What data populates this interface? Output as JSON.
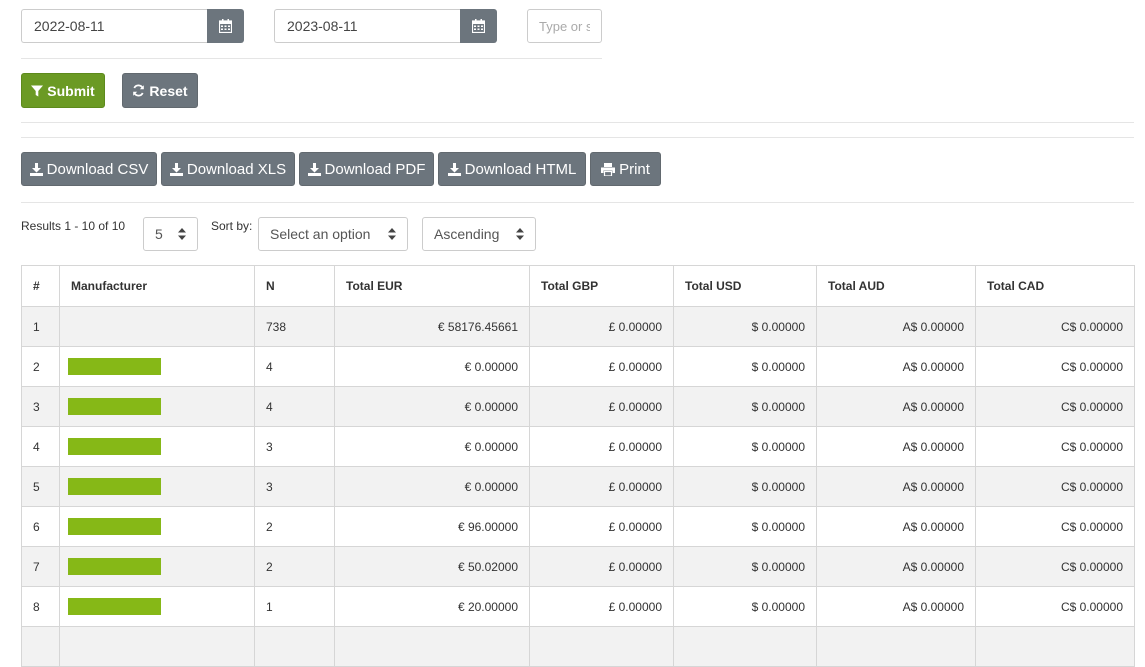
{
  "filters": {
    "date_from": "2022-08-11",
    "date_to": "2023-08-11",
    "search_placeholder": "Type or s"
  },
  "actions": {
    "submit_label": "Submit",
    "reset_label": "Reset"
  },
  "downloads": {
    "csv_label": "Download CSV",
    "xls_label": "Download XLS",
    "pdf_label": "Download PDF",
    "html_label": "Download HTML",
    "print_label": "Print"
  },
  "results": {
    "summary": "Results 1 - 10 of 10",
    "per_page": "5",
    "sort_by_label": "Sort by:",
    "sort_option": "Select an option",
    "sort_order": "Ascending"
  },
  "table": {
    "headers": [
      "#",
      "Manufacturer",
      "N",
      "Total EUR",
      "Total GBP",
      "Total USD",
      "Total AUD",
      "Total CAD"
    ],
    "rows": [
      {
        "idx": "1",
        "redacted": false,
        "n": "738",
        "eur": "€ 58176.45661",
        "gbp": "£ 0.00000",
        "usd": "$ 0.00000",
        "aud": "A$ 0.00000",
        "cad": "C$ 0.00000"
      },
      {
        "idx": "2",
        "redacted": true,
        "n": "4",
        "eur": "€ 0.00000",
        "gbp": "£ 0.00000",
        "usd": "$ 0.00000",
        "aud": "A$ 0.00000",
        "cad": "C$ 0.00000"
      },
      {
        "idx": "3",
        "redacted": true,
        "n": "4",
        "eur": "€ 0.00000",
        "gbp": "£ 0.00000",
        "usd": "$ 0.00000",
        "aud": "A$ 0.00000",
        "cad": "C$ 0.00000"
      },
      {
        "idx": "4",
        "redacted": true,
        "n": "3",
        "eur": "€ 0.00000",
        "gbp": "£ 0.00000",
        "usd": "$ 0.00000",
        "aud": "A$ 0.00000",
        "cad": "C$ 0.00000"
      },
      {
        "idx": "5",
        "redacted": true,
        "n": "3",
        "eur": "€ 0.00000",
        "gbp": "£ 0.00000",
        "usd": "$ 0.00000",
        "aud": "A$ 0.00000",
        "cad": "C$ 0.00000"
      },
      {
        "idx": "6",
        "redacted": true,
        "n": "2",
        "eur": "€ 96.00000",
        "gbp": "£ 0.00000",
        "usd": "$ 0.00000",
        "aud": "A$ 0.00000",
        "cad": "C$ 0.00000"
      },
      {
        "idx": "7",
        "redacted": true,
        "n": "2",
        "eur": "€ 50.02000",
        "gbp": "£ 0.00000",
        "usd": "$ 0.00000",
        "aud": "A$ 0.00000",
        "cad": "C$ 0.00000"
      },
      {
        "idx": "8",
        "redacted": true,
        "n": "1",
        "eur": "€ 20.00000",
        "gbp": "£ 0.00000",
        "usd": "$ 0.00000",
        "aud": "A$ 0.00000",
        "cad": "C$ 0.00000"
      },
      {
        "idx": "",
        "redacted": false,
        "n": "",
        "eur": "",
        "gbp": "",
        "usd": "",
        "aud": "",
        "cad": ""
      }
    ]
  },
  "colors": {
    "submit": "#6b9a24",
    "grey_button": "#6c757d",
    "redaction_bar": "#86b817",
    "row_stripe": "#f2f2f2"
  },
  "icons": {
    "calendar": "calendar-icon",
    "filter": "filter-icon",
    "refresh": "refresh-icon",
    "download": "download-icon",
    "print": "print-icon",
    "sort": "sort-arrows-icon"
  }
}
